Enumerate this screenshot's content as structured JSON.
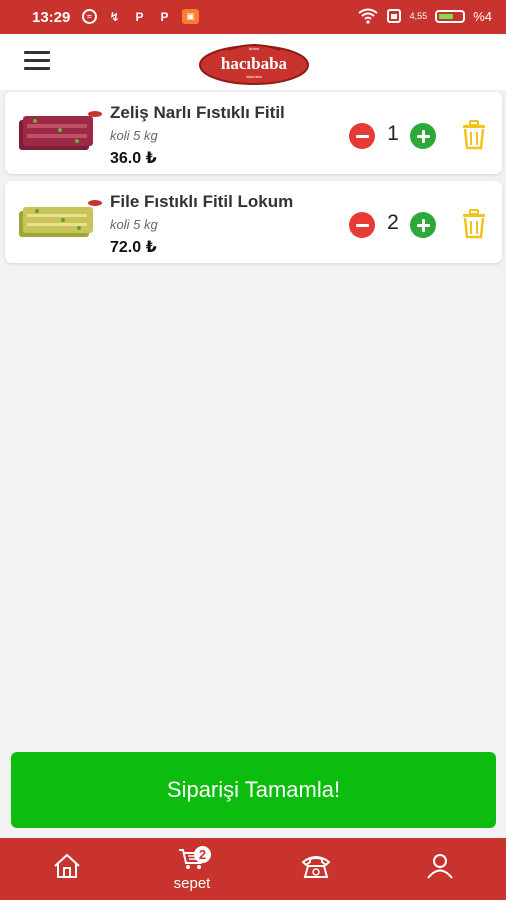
{
  "status": {
    "time": "13:29",
    "net_speed": "4,55",
    "battery_label": "%4"
  },
  "header": {
    "logo_text": "hacıbaba",
    "logo_top": "Anton",
    "logo_sub": "lokumları"
  },
  "cart": {
    "items": [
      {
        "name": "Zeliş Narlı Fıstıklı Fitil",
        "unit": "koli 5 kg",
        "price": "36.0 ₺",
        "qty": "1"
      },
      {
        "name": "File Fıstıklı Fitil Lokum",
        "unit": "koli 5 kg",
        "price": "72.0 ₺",
        "qty": "2"
      }
    ]
  },
  "checkout_label": "Siparişi Tamamla!",
  "nav": {
    "cart_label": "sepet",
    "cart_badge": "2"
  },
  "colors": {
    "brand_red": "#c8332d",
    "checkout_green": "#0cbc0e",
    "minus_red": "#e53a35",
    "plus_green": "#2ea839",
    "trash_yellow": "#f0c419"
  },
  "icons": {
    "menu": "hamburger-icon",
    "remove": "trash-icon",
    "home": "home-icon",
    "cart": "shopping-cart-icon",
    "phone": "telephone-icon",
    "profile": "user-icon"
  }
}
